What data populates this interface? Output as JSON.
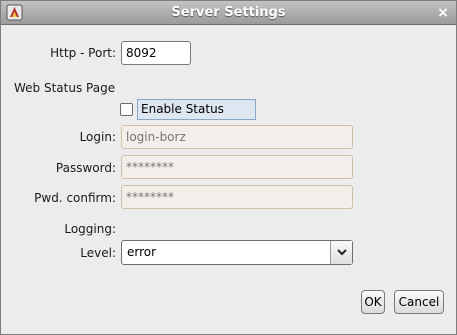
{
  "window": {
    "title": "Server Settings",
    "close_label": "×"
  },
  "form": {
    "http_port_label": "Http - Port:",
    "http_port_value": "8092",
    "web_status_heading": "Web Status Page",
    "enable_status_label": "Enable Status page",
    "enable_status_checked": false,
    "login_label": "Login:",
    "login_placeholder": "login-borz",
    "password_label": "Password:",
    "password_placeholder": "********",
    "pwd_confirm_label": "Pwd. confirm:",
    "pwd_confirm_placeholder": "********",
    "logging_heading": "Logging:",
    "level_label": "Level:",
    "level_value": "error"
  },
  "buttons": {
    "ok": "OK",
    "cancel": "Cancel"
  },
  "icons": {
    "app": "app-icon",
    "close": "close-icon",
    "dropdown": "chevron-down-icon"
  },
  "colors": {
    "titlebar": "#9b9b9b",
    "window_bg": "#ececec",
    "disabled_border": "#cdbfa8",
    "focus_highlight": "#dde6f1"
  }
}
